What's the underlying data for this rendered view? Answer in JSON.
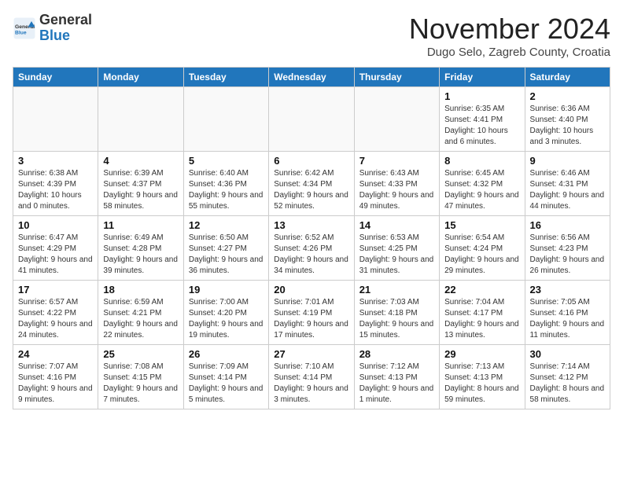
{
  "header": {
    "logo_general": "General",
    "logo_blue": "Blue",
    "month_title": "November 2024",
    "location": "Dugo Selo, Zagreb County, Croatia"
  },
  "weekdays": [
    "Sunday",
    "Monday",
    "Tuesday",
    "Wednesday",
    "Thursday",
    "Friday",
    "Saturday"
  ],
  "weeks": [
    [
      {
        "num": "",
        "info": ""
      },
      {
        "num": "",
        "info": ""
      },
      {
        "num": "",
        "info": ""
      },
      {
        "num": "",
        "info": ""
      },
      {
        "num": "",
        "info": ""
      },
      {
        "num": "1",
        "info": "Sunrise: 6:35 AM\nSunset: 4:41 PM\nDaylight: 10 hours and 6 minutes."
      },
      {
        "num": "2",
        "info": "Sunrise: 6:36 AM\nSunset: 4:40 PM\nDaylight: 10 hours and 3 minutes."
      }
    ],
    [
      {
        "num": "3",
        "info": "Sunrise: 6:38 AM\nSunset: 4:39 PM\nDaylight: 10 hours and 0 minutes."
      },
      {
        "num": "4",
        "info": "Sunrise: 6:39 AM\nSunset: 4:37 PM\nDaylight: 9 hours and 58 minutes."
      },
      {
        "num": "5",
        "info": "Sunrise: 6:40 AM\nSunset: 4:36 PM\nDaylight: 9 hours and 55 minutes."
      },
      {
        "num": "6",
        "info": "Sunrise: 6:42 AM\nSunset: 4:34 PM\nDaylight: 9 hours and 52 minutes."
      },
      {
        "num": "7",
        "info": "Sunrise: 6:43 AM\nSunset: 4:33 PM\nDaylight: 9 hours and 49 minutes."
      },
      {
        "num": "8",
        "info": "Sunrise: 6:45 AM\nSunset: 4:32 PM\nDaylight: 9 hours and 47 minutes."
      },
      {
        "num": "9",
        "info": "Sunrise: 6:46 AM\nSunset: 4:31 PM\nDaylight: 9 hours and 44 minutes."
      }
    ],
    [
      {
        "num": "10",
        "info": "Sunrise: 6:47 AM\nSunset: 4:29 PM\nDaylight: 9 hours and 41 minutes."
      },
      {
        "num": "11",
        "info": "Sunrise: 6:49 AM\nSunset: 4:28 PM\nDaylight: 9 hours and 39 minutes."
      },
      {
        "num": "12",
        "info": "Sunrise: 6:50 AM\nSunset: 4:27 PM\nDaylight: 9 hours and 36 minutes."
      },
      {
        "num": "13",
        "info": "Sunrise: 6:52 AM\nSunset: 4:26 PM\nDaylight: 9 hours and 34 minutes."
      },
      {
        "num": "14",
        "info": "Sunrise: 6:53 AM\nSunset: 4:25 PM\nDaylight: 9 hours and 31 minutes."
      },
      {
        "num": "15",
        "info": "Sunrise: 6:54 AM\nSunset: 4:24 PM\nDaylight: 9 hours and 29 minutes."
      },
      {
        "num": "16",
        "info": "Sunrise: 6:56 AM\nSunset: 4:23 PM\nDaylight: 9 hours and 26 minutes."
      }
    ],
    [
      {
        "num": "17",
        "info": "Sunrise: 6:57 AM\nSunset: 4:22 PM\nDaylight: 9 hours and 24 minutes."
      },
      {
        "num": "18",
        "info": "Sunrise: 6:59 AM\nSunset: 4:21 PM\nDaylight: 9 hours and 22 minutes."
      },
      {
        "num": "19",
        "info": "Sunrise: 7:00 AM\nSunset: 4:20 PM\nDaylight: 9 hours and 19 minutes."
      },
      {
        "num": "20",
        "info": "Sunrise: 7:01 AM\nSunset: 4:19 PM\nDaylight: 9 hours and 17 minutes."
      },
      {
        "num": "21",
        "info": "Sunrise: 7:03 AM\nSunset: 4:18 PM\nDaylight: 9 hours and 15 minutes."
      },
      {
        "num": "22",
        "info": "Sunrise: 7:04 AM\nSunset: 4:17 PM\nDaylight: 9 hours and 13 minutes."
      },
      {
        "num": "23",
        "info": "Sunrise: 7:05 AM\nSunset: 4:16 PM\nDaylight: 9 hours and 11 minutes."
      }
    ],
    [
      {
        "num": "24",
        "info": "Sunrise: 7:07 AM\nSunset: 4:16 PM\nDaylight: 9 hours and 9 minutes."
      },
      {
        "num": "25",
        "info": "Sunrise: 7:08 AM\nSunset: 4:15 PM\nDaylight: 9 hours and 7 minutes."
      },
      {
        "num": "26",
        "info": "Sunrise: 7:09 AM\nSunset: 4:14 PM\nDaylight: 9 hours and 5 minutes."
      },
      {
        "num": "27",
        "info": "Sunrise: 7:10 AM\nSunset: 4:14 PM\nDaylight: 9 hours and 3 minutes."
      },
      {
        "num": "28",
        "info": "Sunrise: 7:12 AM\nSunset: 4:13 PM\nDaylight: 9 hours and 1 minute."
      },
      {
        "num": "29",
        "info": "Sunrise: 7:13 AM\nSunset: 4:13 PM\nDaylight: 8 hours and 59 minutes."
      },
      {
        "num": "30",
        "info": "Sunrise: 7:14 AM\nSunset: 4:12 PM\nDaylight: 8 hours and 58 minutes."
      }
    ]
  ]
}
